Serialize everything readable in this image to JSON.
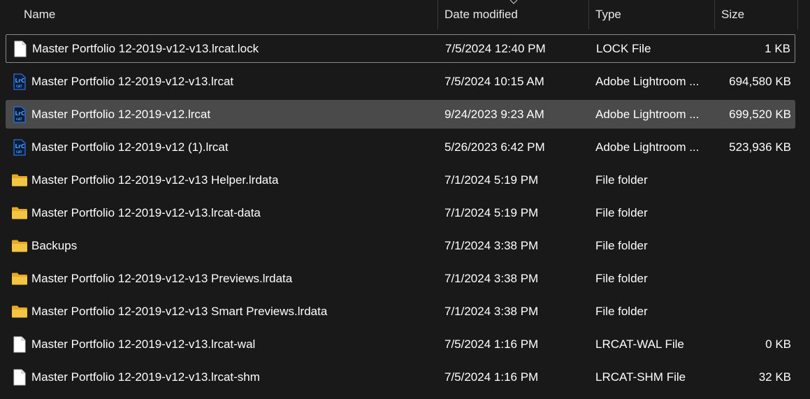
{
  "header": {
    "name": "Name",
    "date_modified": "Date modified",
    "type": "Type",
    "size": "Size"
  },
  "colors": {
    "background": "#191919",
    "selected_row": "#4a4a4a",
    "folder": "#f4c542",
    "lrcat_icon": "#2f6fd6"
  },
  "files": [
    {
      "name": "Master Portfolio 12-2019-v12-v13.lrcat.lock",
      "date": "7/5/2024 12:40 PM",
      "type": "LOCK File",
      "size": "1 KB",
      "icon": "document-icon",
      "state": "focused"
    },
    {
      "name": "Master Portfolio 12-2019-v12-v13.lrcat",
      "date": "7/5/2024 10:15 AM",
      "type": "Adobe Lightroom ...",
      "size": "694,580 KB",
      "icon": "lightroom-catalog-icon",
      "state": ""
    },
    {
      "name": "Master Portfolio 12-2019-v12.lrcat",
      "date": "9/24/2023 9:23 AM",
      "type": "Adobe Lightroom ...",
      "size": "699,520 KB",
      "icon": "lightroom-catalog-icon",
      "state": "selected"
    },
    {
      "name": "Master Portfolio 12-2019-v12 (1).lrcat",
      "date": "5/26/2023 6:42 PM",
      "type": "Adobe Lightroom ...",
      "size": "523,936 KB",
      "icon": "lightroom-catalog-icon",
      "state": ""
    },
    {
      "name": "Master Portfolio 12-2019-v12-v13 Helper.lrdata",
      "date": "7/1/2024 5:19 PM",
      "type": "File folder",
      "size": "",
      "icon": "folder-icon",
      "state": ""
    },
    {
      "name": "Master Portfolio 12-2019-v12-v13.lrcat-data",
      "date": "7/1/2024 5:19 PM",
      "type": "File folder",
      "size": "",
      "icon": "folder-icon",
      "state": ""
    },
    {
      "name": "Backups",
      "date": "7/1/2024 3:38 PM",
      "type": "File folder",
      "size": "",
      "icon": "folder-icon",
      "state": ""
    },
    {
      "name": "Master Portfolio 12-2019-v12-v13 Previews.lrdata",
      "date": "7/1/2024 3:38 PM",
      "type": "File folder",
      "size": "",
      "icon": "folder-icon",
      "state": ""
    },
    {
      "name": "Master Portfolio 12-2019-v12-v13 Smart Previews.lrdata",
      "date": "7/1/2024 3:38 PM",
      "type": "File folder",
      "size": "",
      "icon": "folder-icon",
      "state": ""
    },
    {
      "name": "Master Portfolio 12-2019-v12-v13.lrcat-wal",
      "date": "7/5/2024 1:16 PM",
      "type": "LRCAT-WAL File",
      "size": "0 KB",
      "icon": "document-icon",
      "state": ""
    },
    {
      "name": "Master Portfolio 12-2019-v12-v13.lrcat-shm",
      "date": "7/5/2024 1:16 PM",
      "type": "LRCAT-SHM File",
      "size": "32 KB",
      "icon": "document-icon",
      "state": ""
    }
  ]
}
